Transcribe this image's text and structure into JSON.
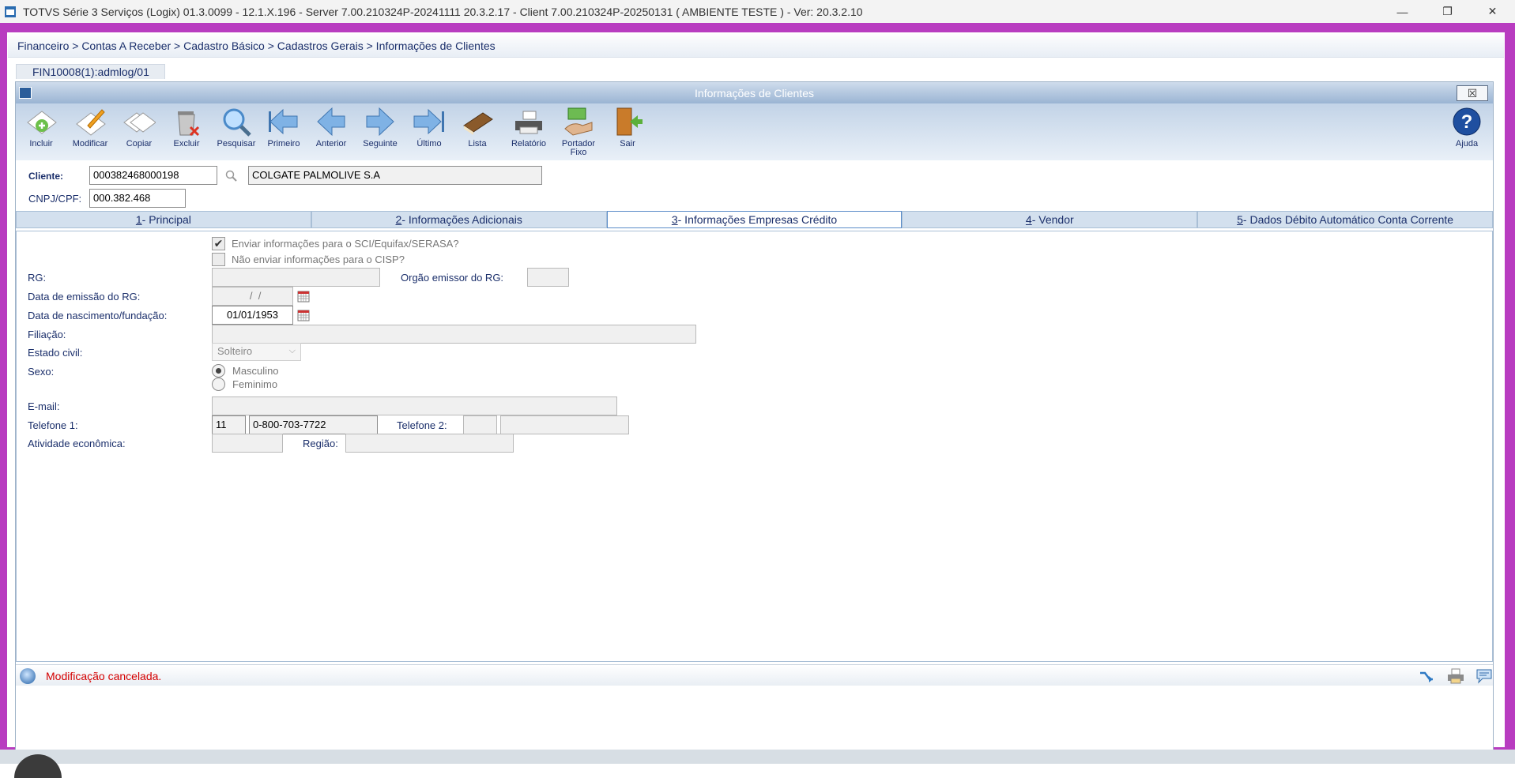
{
  "window": {
    "title": "TOTVS Série 3 Serviços (Logix) 01.3.0099  -  12.1.X.196 - Server 7.00.210324P-20241111 20.3.2.17 - Client 7.00.210324P-20250131    ( AMBIENTE TESTE )  - Ver: 20.3.2.10",
    "minimize": "—",
    "restore": "❐",
    "close": "✕"
  },
  "breadcrumb": "Financeiro > Contas A Receber > Cadastro Básico > Cadastros Gerais > Informações de Clientes",
  "program_tab": "FIN10008(1):admlog/01",
  "app": {
    "title": "Informações de Clientes",
    "close": "☒"
  },
  "toolbar": {
    "incluir": "Incluir",
    "modificar": "Modificar",
    "copiar": "Copiar",
    "excluir": "Excluir",
    "pesquisar": "Pesquisar",
    "primeiro": "Primeiro",
    "anterior": "Anterior",
    "seguinte": "Seguinte",
    "ultimo": "Último",
    "lista": "Lista",
    "relatorio": "Relatório",
    "portador_fixo": "Portador Fixo",
    "sair": "Sair",
    "ajuda": "Ajuda"
  },
  "header": {
    "cliente_label": "Cliente:",
    "cliente_code": "000382468000198",
    "cliente_name": "COLGATE PALMOLIVE S.A",
    "cnpj_label": "CNPJ/CPF:",
    "cnpj_value": "000.382.468"
  },
  "tabs": [
    {
      "num": "1",
      "label": " - Principal"
    },
    {
      "num": "2",
      "label": " - Informações Adicionais"
    },
    {
      "num": "3",
      "label": " - Informações Empresas Crédito"
    },
    {
      "num": "4",
      "label": " - Vendor"
    },
    {
      "num": "5",
      "label": " - Dados Débito Automático Conta Corrente"
    }
  ],
  "form": {
    "chk_sci": "Enviar informações para o SCI/Equifax/SERASA?",
    "chk_cisp": "Não enviar informações para o CISP?",
    "rg_label": "RG:",
    "rg_value": "",
    "orgao_label": "Orgão emissor do RG:",
    "orgao_value": "",
    "emissao_label": "Data de emissão do RG:",
    "emissao_value": "  /  /",
    "nasc_label": "Data de nascimento/fundação:",
    "nasc_value": "01/01/1953",
    "filiacao_label": "Filiação:",
    "filiacao_value": "",
    "estado_label": "Estado civil:",
    "estado_value": "Solteiro",
    "sexo_label": "Sexo:",
    "sexo_masc": "Masculino",
    "sexo_fem": "Feminimo",
    "email_label": "E-mail:",
    "email_value": "",
    "tel1_label": "Telefone 1:",
    "tel1_ddd": "11",
    "tel1_num": "0-800-703-7722",
    "tel2_label": "Telefone 2:",
    "tel2_ddd": "",
    "tel2_num": "",
    "ativ_label": "Atividade econômica:",
    "ativ_value": "",
    "regiao_label": "Região:",
    "regiao_value": ""
  },
  "status": {
    "message": "Modificação cancelada."
  }
}
